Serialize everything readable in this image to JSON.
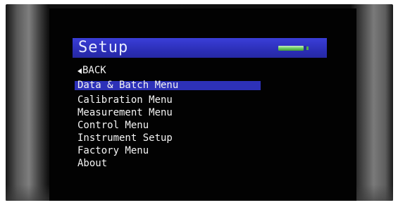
{
  "screen": {
    "title": "Setup",
    "back_label": "BACK",
    "battery_level": 0.9
  },
  "menu": {
    "items": [
      {
        "label": "Data & Batch Menu",
        "selected": true
      },
      {
        "label": "Calibration Menu",
        "selected": false
      },
      {
        "label": "Measurement Menu",
        "selected": false
      },
      {
        "label": "Control Menu",
        "selected": false
      },
      {
        "label": "Instrument Setup",
        "selected": false
      },
      {
        "label": "Factory Menu",
        "selected": false
      },
      {
        "label": "About",
        "selected": false
      }
    ]
  },
  "colors": {
    "title_bar": "#3a3ed8",
    "highlight": "#2d31b8",
    "screen_background": "#020202",
    "text": "#f4f4f4",
    "battery": "#6fcf62"
  },
  "icons": {
    "back": "triangle-left-icon",
    "battery": "battery-icon"
  }
}
